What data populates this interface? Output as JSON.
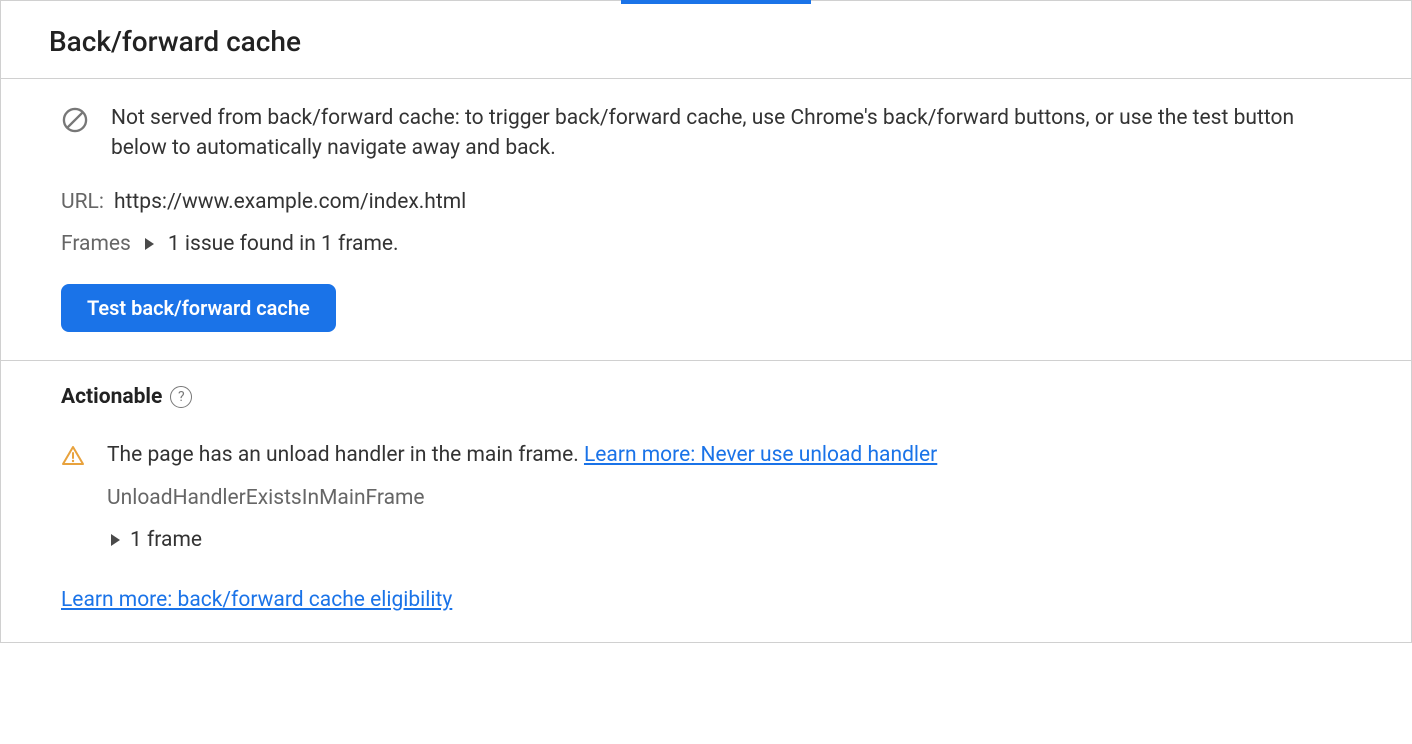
{
  "page_title": "Back/forward cache",
  "info_message": "Not served from back/forward cache: to trigger back/forward cache, use Chrome's back/forward buttons, or use the test button below to automatically navigate away and back.",
  "url": {
    "label": "URL:",
    "value": "https://www.example.com/index.html"
  },
  "frames": {
    "label": "Frames",
    "summary": "1 issue found in 1 frame."
  },
  "test_button_label": "Test back/forward cache",
  "actionable": {
    "heading": "Actionable",
    "issue_text": "The page has an unload handler in the main frame. ",
    "issue_link": "Learn more: Never use unload handler",
    "code": "UnloadHandlerExistsInMainFrame",
    "frame_count": "1 frame"
  },
  "eligibility_link": "Learn more: back/forward cache eligibility"
}
